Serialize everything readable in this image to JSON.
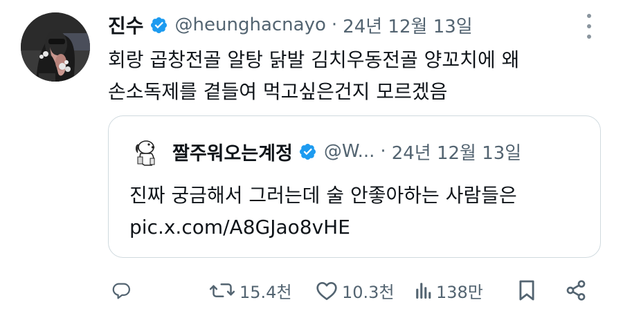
{
  "tweet": {
    "author_name": "진수",
    "handle": "@heunghacnayo",
    "separator": "·",
    "date": "24년 12월 13일",
    "text_lines": [
      "회랑 곱창전골 알탕 닭발 김치우동전골 양꼬치에 왜",
      "손소독제를 곁들여 먹고싶은건지 모르겠음"
    ]
  },
  "quote": {
    "author_name": "짤주워오는계정",
    "handle": "@W...",
    "separator": "·",
    "date": "24년 12월 13일",
    "text_lines": [
      "진짜 궁금해서 그러는데 술 안좋아하는 사람들은",
      "pic.x.com/A8GJao8vHE"
    ]
  },
  "actions": {
    "retweets": "15.4천",
    "likes": "10.3천",
    "views": "138만"
  },
  "icons": {
    "reply": "reply-icon",
    "retweet": "retweet-icon",
    "like": "heart-icon",
    "views": "views-icon",
    "bookmark": "bookmark-icon",
    "share": "share-icon",
    "more": "more-icon",
    "verified": "verified-badge-icon"
  },
  "colors": {
    "text": "#0f1419",
    "muted": "#536471",
    "verified": "#1d9bf0",
    "border": "#cfd9de"
  }
}
